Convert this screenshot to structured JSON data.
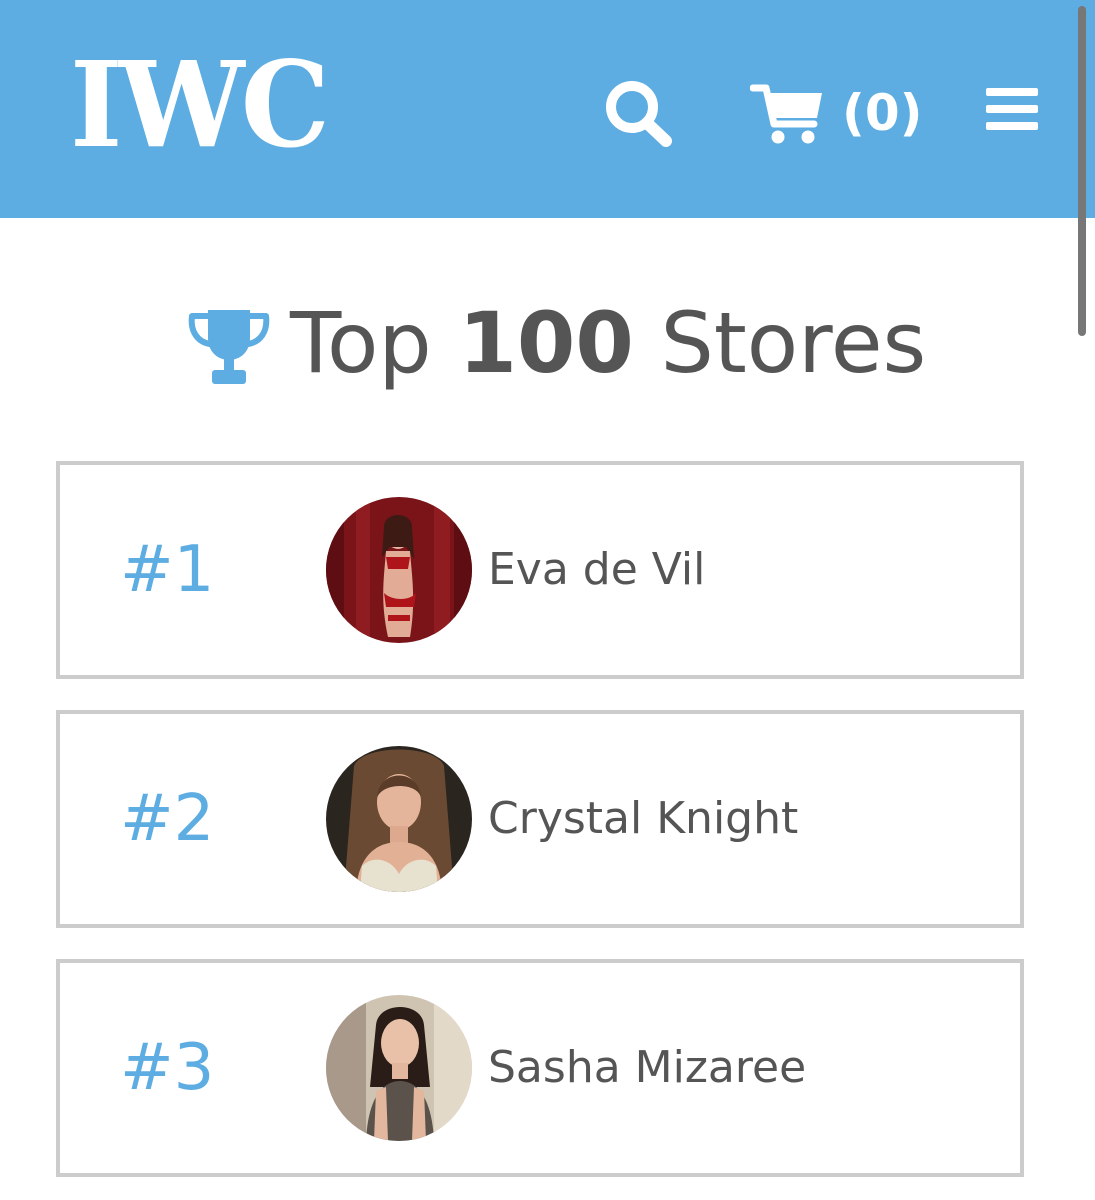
{
  "header": {
    "logo": "IWC",
    "cart_count": "(0)",
    "search_icon": "search-icon",
    "cart_icon": "cart-icon",
    "menu_icon": "hamburger-menu-icon",
    "background_color": "#5dade2"
  },
  "page": {
    "title_prefix": "Top ",
    "title_number": "100",
    "title_suffix": " Stores",
    "title_icon": "trophy-icon",
    "accent_color": "#5dade2"
  },
  "stores": [
    {
      "rank": "#1",
      "name": "Eva de Vil"
    },
    {
      "rank": "#2",
      "name": "Crystal Knight"
    },
    {
      "rank": "#3",
      "name": "Sasha Mizaree"
    }
  ]
}
